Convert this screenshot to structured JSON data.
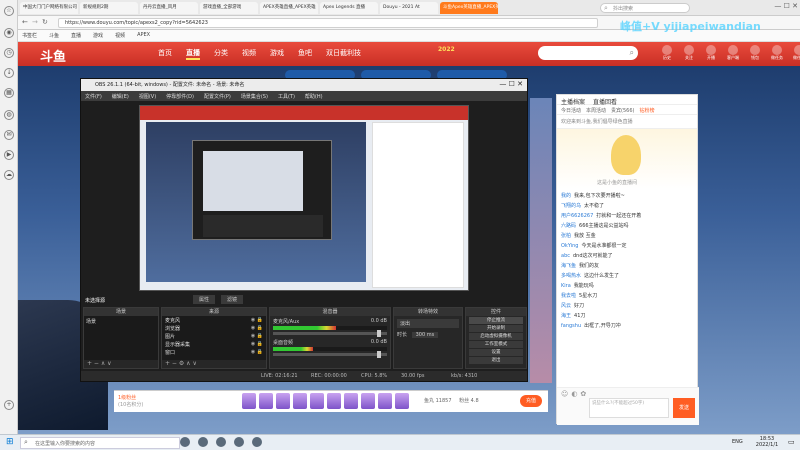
{
  "browser": {
    "tabs": [
      "中国大门门户网络有限公司",
      "新规规则2期",
      "丹丹云直播_风月",
      "游戏直播_全部游戏",
      "APEX英雄直播_APEX英雄",
      "Apex Legends 直播",
      "Douyu - 2021 At",
      "斗鱼Apex英雄直播_APEX英雄官方"
    ],
    "active_tab": 7,
    "url": "https://www.douyu.com/topic/apexs2_copy?rid=5642623",
    "search_placeholder": "抖出搜索",
    "bookmarks": [
      "书签栏",
      "斗鱼",
      "直播",
      "游戏",
      "视频",
      "APEX"
    ]
  },
  "site": {
    "logo": "斗鱼",
    "nav": [
      "首页",
      "直播",
      "分类",
      "视频",
      "游戏",
      "鱼吧",
      "双日截利技"
    ],
    "active_nav": "直播",
    "nav_promo": "2022",
    "right_icons": [
      "历史",
      "关注",
      "开播",
      "客户端",
      "钱包",
      "做任务",
      "做任务"
    ],
    "watermark": "峰值+V yijiapeiwandian"
  },
  "obs": {
    "title": "OBS 26.1.1 (64-bit, windows) - 配置文件: 未命名 - 场景: 未命名",
    "menu": [
      "文件(F)",
      "编辑(E)",
      "视图(V)",
      "停靠部件(D)",
      "配置文件(P)",
      "场景集合(S)",
      "工具(T)",
      "帮助(H)"
    ],
    "source_bar": [
      "未选择源",
      "属性",
      "滤镜"
    ],
    "panels": {
      "scenes": "场景",
      "sources": "来源",
      "mixer": "混音器",
      "transitions": "转场特效",
      "controls": "控件"
    },
    "scene_items": [
      "场景"
    ],
    "source_items": [
      "麦克风",
      "浏览器",
      "图片",
      "显示器采集",
      "窗口"
    ],
    "mixer_tracks": [
      {
        "name": "麦克风/Aux",
        "db": "0.0 dB",
        "level": 0.55
      },
      {
        "name": "桌面音频",
        "db": "0.0 dB",
        "level": 0.35
      }
    ],
    "transition": "淡出",
    "duration_label": "时长",
    "duration_value": "300 ms",
    "controls": [
      "停止推流",
      "开始录制",
      "启动虚拟摄像机",
      "工作室模式",
      "设置",
      "退出"
    ],
    "status": {
      "live": "LIVE: 02:16:21",
      "rec": "REC: 00:00:00",
      "cpu": "CPU: 5.8%",
      "fps": "30.00 fps",
      "kbps": "kb/s: 4310"
    }
  },
  "room": {
    "tabs": [
      "主播档案",
      "直播回看"
    ],
    "chat_tabs": [
      "今日活动",
      "本周活动",
      "贵宾(566)",
      "钻粉榜"
    ],
    "active_chat_tab": "钻粉榜",
    "welcome": "欢迎来到斗鱼,我们倡导绿色直播",
    "avatar_banner": "这是小鱼的直播间",
    "messages": [
      {
        "user": "我的",
        "text": "我来,包下次要开播啦~"
      },
      {
        "user": "飞翔的乌",
        "text": "太不稳了"
      },
      {
        "user": "用户6626267",
        "text": "打就和一起还在开着"
      },
      {
        "user": "六路码",
        "text": "666主播这是公益站吗"
      },
      {
        "user": "张柏",
        "text": "我放 互金"
      },
      {
        "user": "OkYing",
        "text": "今天是水准都很一定"
      },
      {
        "user": "abc",
        "text": "dnd这次可就能了"
      },
      {
        "user": "海飞鱼",
        "text": "我们的友"
      },
      {
        "user": "多喝热水",
        "text": "这边什么发生了"
      },
      {
        "user": "Kira",
        "text": "我能玩吗"
      },
      {
        "user": "我去啦",
        "text": "5星水刀"
      },
      {
        "user": "风云",
        "text": "好刀"
      },
      {
        "user": "海王",
        "text": "41刀"
      },
      {
        "user": "fangshu",
        "text": "出框了,开导刀冲"
      }
    ],
    "input_placeholder": "说些什么?(不能超过50字)",
    "send_button": "发送",
    "gift_count_label": "鱼丸 11857",
    "gift_level": "粉丝 4.8",
    "gift_bar_left": "1级粉丝",
    "gift_bar_left_sub": "(10名积分)",
    "recharge_button": "充值"
  },
  "taskbar": {
    "search_placeholder": "在这里输入你要搜索的内容",
    "time": "18:53",
    "date": "2022/1/1",
    "lang": "ENG"
  },
  "colors": {
    "douyu_orange": "#ff5d23",
    "douyu_red": "#e64032",
    "obs_dark": "#2b2b2b",
    "live_green": "#32c832",
    "meter_red": "#d23232"
  }
}
